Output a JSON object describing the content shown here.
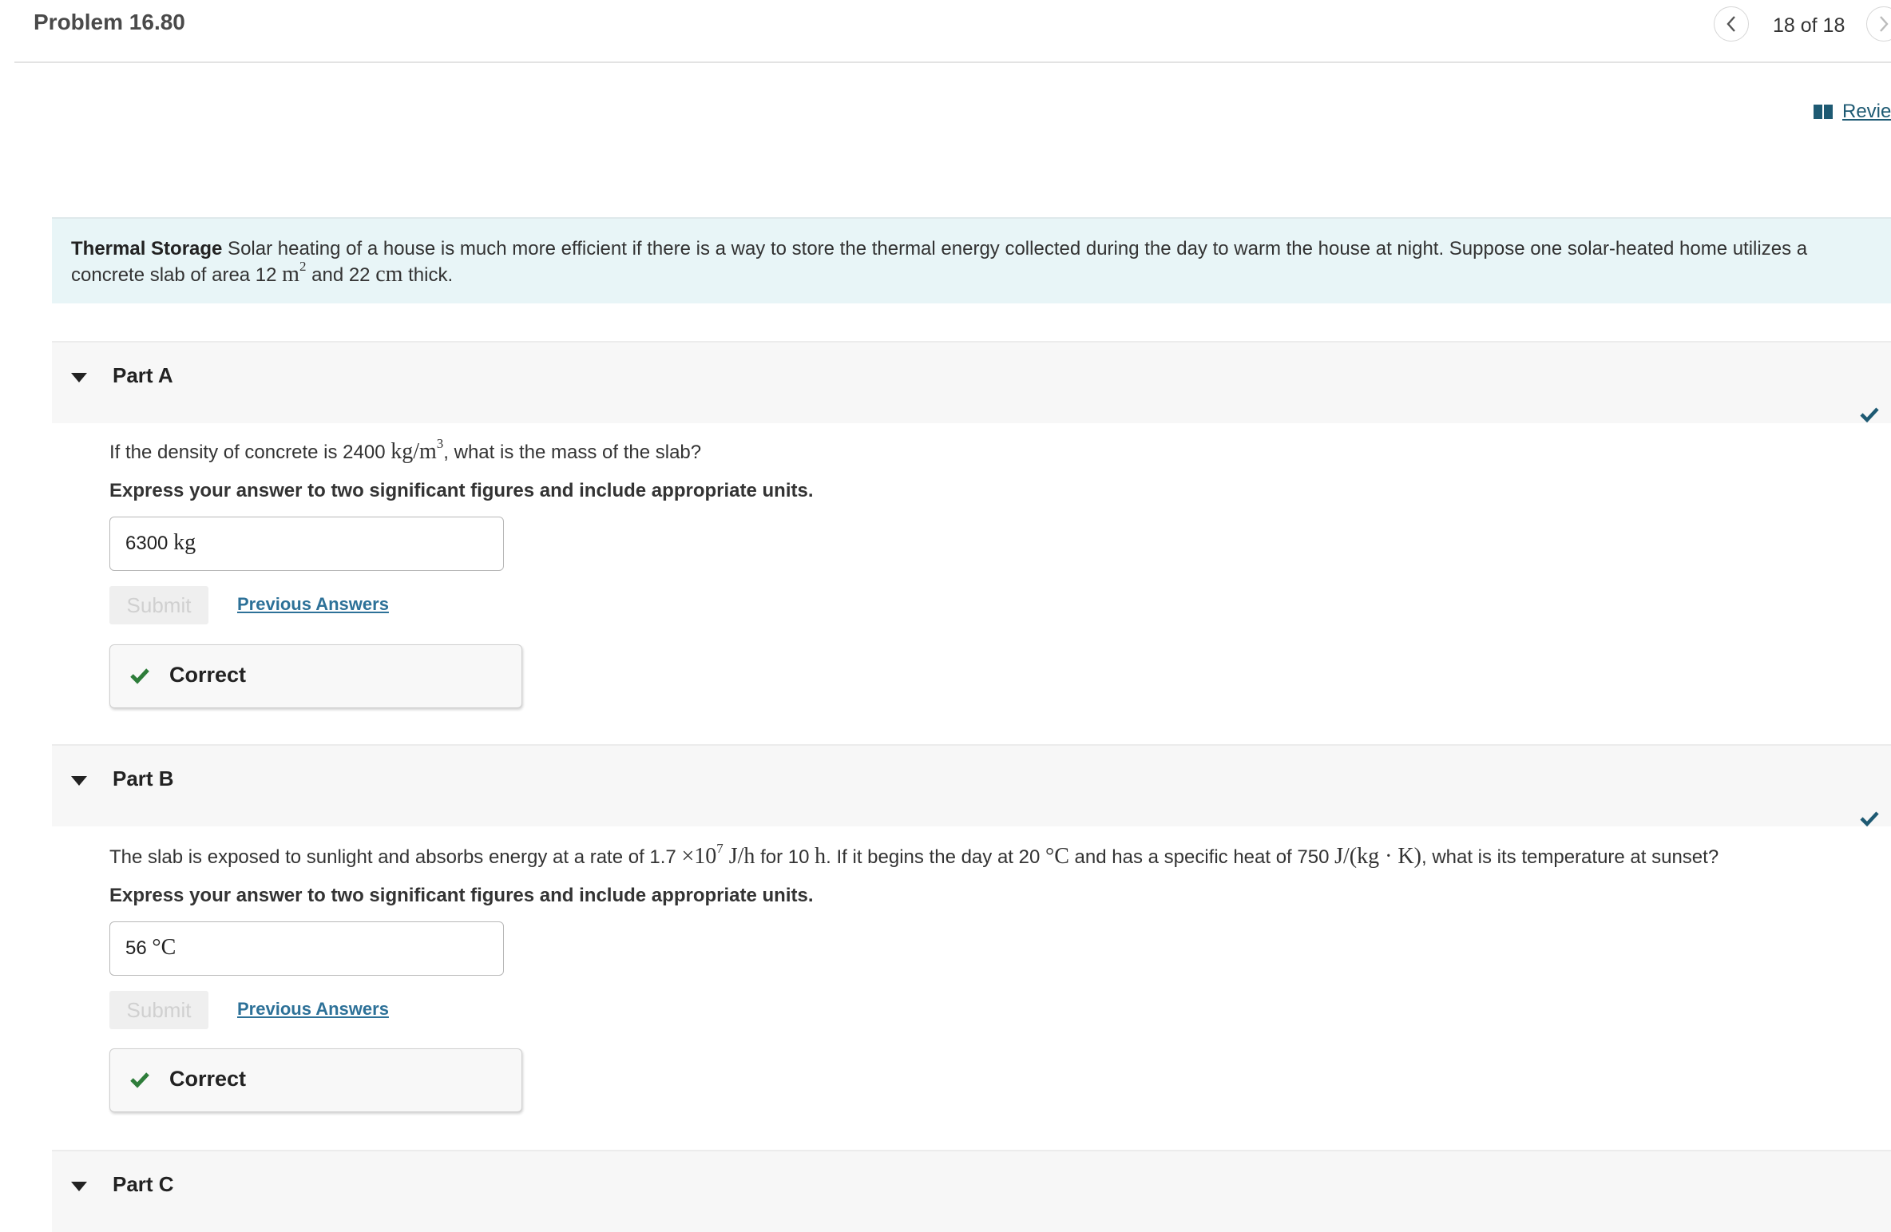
{
  "header": {
    "title": "Problem 16.80",
    "counter": "18 of 18",
    "prev_icon": "chevron-left-icon",
    "next_icon": "chevron-right-icon"
  },
  "review_link": {
    "icon": "book-icon",
    "label": "Revie"
  },
  "intro": {
    "bold_title": "Thermal Storage",
    "text_before_area": " Solar heating of a house is much more efficient if there is a way to store the thermal energy collected during the day to warm the house at night. Suppose one solar-heated home utilizes a concrete slab of area 12 ",
    "area_unit": "m",
    "area_exp": "2",
    "text_mid": " and 22 ",
    "thick_unit": "cm",
    "text_end": " thick."
  },
  "parts": [
    {
      "label": "Part A",
      "status_icon": "checkmark-icon",
      "question": {
        "pre": "If the density of concrete is 2400 ",
        "unit": "kg/m",
        "unit_exp": "3",
        "post": ", what is the mass of the slab?"
      },
      "instruction": "Express your answer to two significant figures and include appropriate units.",
      "answer_number": "6300 ",
      "answer_unit": "kg",
      "submit_label": "Submit",
      "previous_answers_label": "Previous Answers",
      "feedback": "Correct"
    },
    {
      "label": "Part B",
      "status_icon": "checkmark-icon",
      "question": {
        "t1": "The slab is exposed to sunlight and absorbs energy at a rate of 1.7 ",
        "m1": "×10",
        "m1_exp": "7",
        "m1_unit": " J/h",
        "t2": " for 10 ",
        "m2": "h",
        "t3": ". If it begins the day at 20 ",
        "m3": "°C",
        "t4": " and has a specific heat of 750 ",
        "m4": "J/(kg · K)",
        "t5": ", what is its temperature at sunset?"
      },
      "instruction": "Express your answer to two significant figures and include appropriate units.",
      "answer_number": "56 ",
      "answer_unit": "°C",
      "submit_label": "Submit",
      "previous_answers_label": "Previous Answers",
      "feedback": "Correct"
    },
    {
      "label": "Part C"
    }
  ],
  "colors": {
    "accent": "#1e5a73",
    "link": "#2d7198",
    "correct_green": "#2e7d3a",
    "intro_bg": "#e8f5f7",
    "part_header_bg": "#f7f7f7"
  }
}
